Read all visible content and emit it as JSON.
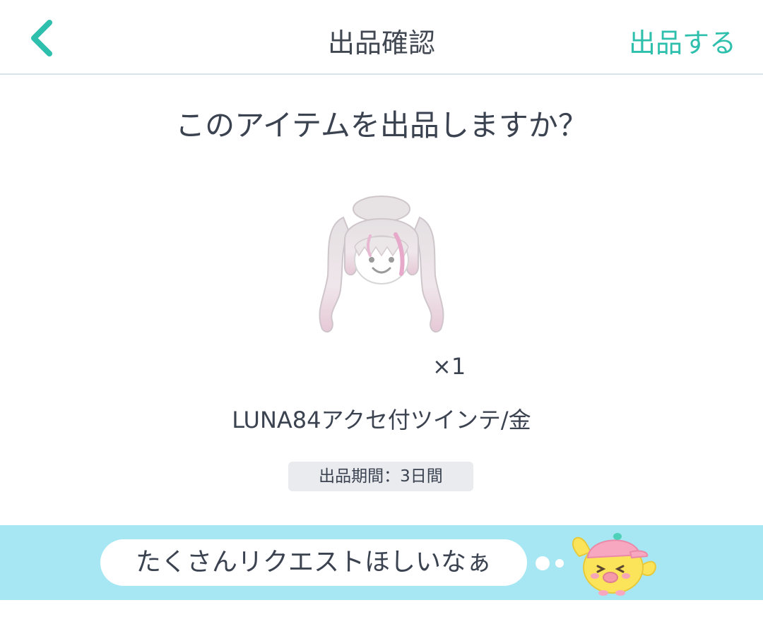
{
  "header": {
    "title": "出品確認",
    "submit_label": "出品する"
  },
  "main": {
    "question": "このアイテムを出品しますか？",
    "quantity": "×1",
    "item_name": "LUNA84アクセ付ツインテ/金",
    "period": "出品期間：3日間"
  },
  "banner": {
    "message": "たくさんリクエストほしいなぁ"
  },
  "colors": {
    "accent": "#2ebfad",
    "banner_bg": "#a6e7f3",
    "badge_bg": "#e9ebee",
    "text": "#3b4250"
  },
  "icons": {
    "back": "chevron-left-icon",
    "item": "twin-tail-hair-item-icon",
    "mascot": "chick-mascot-icon"
  }
}
